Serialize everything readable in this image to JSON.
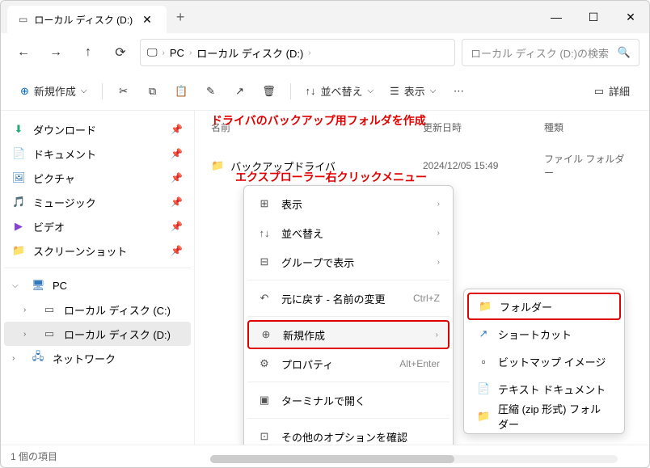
{
  "tab": {
    "title": "ローカル ディスク (D:)"
  },
  "breadcrumb": {
    "pc": "PC",
    "drive": "ローカル ディスク (D:)"
  },
  "search": {
    "placeholder": "ローカル ディスク (D:)の検索"
  },
  "toolbar": {
    "new": "新規作成",
    "sort": "並べ替え",
    "view": "表示",
    "details": "詳細"
  },
  "sidebar": {
    "items": [
      {
        "icon": "⬇",
        "label": "ダウンロード",
        "color": "#2a7"
      },
      {
        "icon": "📄",
        "label": "ドキュメント",
        "color": "#59f"
      },
      {
        "icon": "🖼",
        "label": "ピクチャ",
        "color": "#37b"
      },
      {
        "icon": "🎵",
        "label": "ミュージック",
        "color": "#e55"
      },
      {
        "icon": "▶",
        "label": "ビデオ",
        "color": "#84c"
      },
      {
        "icon": "📁",
        "label": "スクリーンショット",
        "color": "#f0b73c"
      }
    ],
    "pc": "PC",
    "drives": [
      {
        "label": "ローカル ディスク (C:)"
      },
      {
        "label": "ローカル ディスク (D:)"
      }
    ],
    "network": "ネットワーク"
  },
  "columns": {
    "name": "名前",
    "date": "更新日時",
    "type": "種類"
  },
  "annotations": {
    "top": "ドライバのバックアップ用フォルダを作成",
    "mid": "エクスプローラー右クリックメニュー"
  },
  "files": [
    {
      "name": "バックアップドライバ",
      "date": "2024/12/05  15:49",
      "type": "ファイル フォルダー"
    }
  ],
  "context_menu": {
    "items": [
      {
        "icon": "⊞",
        "label": "表示",
        "arrow": true
      },
      {
        "icon": "↑↓",
        "label": "並べ替え",
        "arrow": true
      },
      {
        "icon": "⊟",
        "label": "グループで表示",
        "arrow": true
      },
      {
        "icon": "↶",
        "label": "元に戻す - 名前の変更",
        "shortcut": "Ctrl+Z"
      },
      {
        "icon": "⊕",
        "label": "新規作成",
        "arrow": true,
        "highlighted": true
      },
      {
        "icon": "⚙",
        "label": "プロパティ",
        "shortcut": "Alt+Enter"
      },
      {
        "icon": "▣",
        "label": "ターミナルで開く"
      },
      {
        "icon": "⊡",
        "label": "その他のオプションを確認"
      }
    ]
  },
  "submenu": {
    "items": [
      {
        "icon": "📁",
        "label": "フォルダー",
        "highlighted": true,
        "color": "#f0b73c"
      },
      {
        "icon": "↗",
        "label": "ショートカット",
        "color": "#37b"
      },
      {
        "icon": "▫",
        "label": "ビットマップ イメージ"
      },
      {
        "icon": "📄",
        "label": "テキスト ドキュメント"
      },
      {
        "icon": "📁",
        "label": "圧縮 (zip 形式) フォルダー",
        "color": "#f0b73c"
      }
    ]
  },
  "statusbar": {
    "text": "1 個の項目"
  }
}
